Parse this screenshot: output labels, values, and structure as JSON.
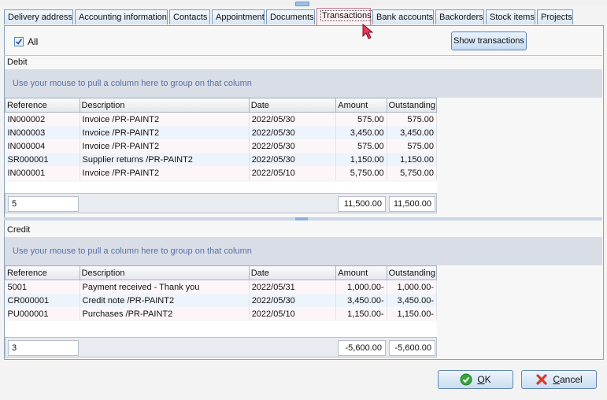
{
  "tabs": [
    {
      "label": "Delivery address"
    },
    {
      "label": "Accounting information"
    },
    {
      "label": "Contacts"
    },
    {
      "label": "Appointment"
    },
    {
      "label": "Documents"
    },
    {
      "label": "Transactions"
    },
    {
      "label": "Bank accounts"
    },
    {
      "label": "Backorders"
    },
    {
      "label": "Stock items"
    },
    {
      "label": "Projects"
    }
  ],
  "active_tab": "Transactions",
  "filter": {
    "all_label": "All",
    "all_checked": true
  },
  "show_transactions_label": "Show transactions",
  "group_hint": "Use your mouse to pull a column here to group on that column",
  "columns": {
    "reference": "Reference",
    "description": "Description",
    "date": "Date",
    "amount": "Amount",
    "outstanding": "Outstanding"
  },
  "debit": {
    "title": "Debit",
    "rows": [
      {
        "reference": "IN000002",
        "description": "Invoice /PR-PAINT2",
        "date": "2022/05/30",
        "amount": "575.00",
        "outstanding": "575.00"
      },
      {
        "reference": "IN000003",
        "description": "Invoice /PR-PAINT2",
        "date": "2022/05/30",
        "amount": "3,450.00",
        "outstanding": "3,450.00"
      },
      {
        "reference": "IN000004",
        "description": "Invoice /PR-PAINT2",
        "date": "2022/05/30",
        "amount": "575.00",
        "outstanding": "575.00"
      },
      {
        "reference": "SR000001",
        "description": "Supplier returns /PR-PAINT2",
        "date": "2022/05/30",
        "amount": "1,150.00",
        "outstanding": "1,150.00"
      },
      {
        "reference": "IN000001",
        "description": "Invoice /PR-PAINT2",
        "date": "2022/05/10",
        "amount": "5,750.00",
        "outstanding": "5,750.00"
      }
    ],
    "footer": {
      "count": "5",
      "amount": "11,500.00",
      "outstanding": "11,500.00"
    }
  },
  "credit": {
    "title": "Credit",
    "rows": [
      {
        "reference": "5001",
        "description": "Payment received - Thank you",
        "date": "2022/05/31",
        "amount": "1,000.00-",
        "outstanding": "1,000.00-"
      },
      {
        "reference": "CR000001",
        "description": "Credit note /PR-PAINT2",
        "date": "2022/05/30",
        "amount": "3,450.00-",
        "outstanding": "3,450.00-"
      },
      {
        "reference": "PU000001",
        "description": "Purchases /PR-PAINT2",
        "date": "2022/05/10",
        "amount": "1,150.00-",
        "outstanding": "1,150.00-"
      }
    ],
    "footer": {
      "count": "3",
      "amount": "-5,600.00",
      "outstanding": "-5,600.00"
    }
  },
  "buttons": {
    "ok": {
      "accel": "O",
      "rest": "K"
    },
    "cancel": {
      "accel": "C",
      "rest": "ancel"
    }
  },
  "colors": {
    "ok_icon": "#3aa63a",
    "cancel_icon": "#d93a2a",
    "active_tab": "#fff0f4"
  }
}
